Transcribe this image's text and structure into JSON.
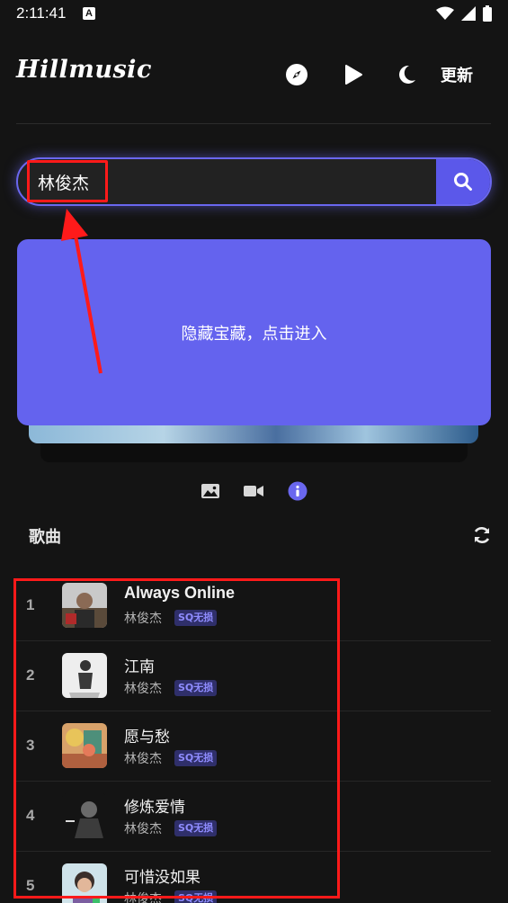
{
  "status": {
    "time": "2:11:41",
    "notif": "A"
  },
  "header": {
    "logo": "Hillmusic",
    "update_label": "更新"
  },
  "search": {
    "value": "林俊杰"
  },
  "banner": {
    "text": "隐藏宝藏，点击进入"
  },
  "section": {
    "title": "歌曲"
  },
  "songs": [
    {
      "rank": "1",
      "title": "Always Online",
      "artist": "林俊杰",
      "tag": "SQ无损"
    },
    {
      "rank": "2",
      "title": "江南",
      "artist": "林俊杰",
      "tag": "SQ无损"
    },
    {
      "rank": "3",
      "title": "愿与愁",
      "artist": "林俊杰",
      "tag": "SQ无损"
    },
    {
      "rank": "4",
      "title": "修炼爱情",
      "artist": "林俊杰",
      "tag": "SQ无损"
    },
    {
      "rank": "5",
      "title": "可惜没如果",
      "artist": "林俊杰",
      "tag": "SQ无损"
    }
  ],
  "colors": {
    "accent": "#6463ee",
    "highlight": "#ff1a1a",
    "background": "#141414"
  },
  "icons": [
    "compass-icon",
    "play-icon",
    "moon-icon",
    "search-icon",
    "image-icon",
    "video-icon",
    "info-icon",
    "refresh-icon"
  ]
}
